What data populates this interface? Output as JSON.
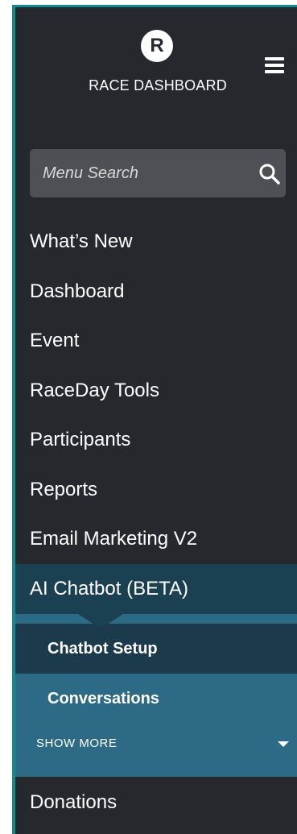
{
  "header": {
    "logo_letter": "R",
    "brand": "RACE DASHBOARD"
  },
  "search": {
    "placeholder": "Menu Search"
  },
  "nav": {
    "items": [
      {
        "label": "What’s New"
      },
      {
        "label": "Dashboard"
      },
      {
        "label": "Event"
      },
      {
        "label": "RaceDay Tools"
      },
      {
        "label": "Participants"
      },
      {
        "label": "Reports"
      },
      {
        "label": "Email Marketing V2"
      },
      {
        "label": "AI Chatbot (BETA)",
        "active": true
      },
      {
        "label": "Donations"
      }
    ],
    "submenu": {
      "items": [
        {
          "label": "Chatbot Setup",
          "active": true
        },
        {
          "label": "Conversations"
        }
      ],
      "show_more": "SHOW  MORE"
    }
  },
  "colors": {
    "sidebar_bg": "#25282d",
    "accent_border": "#138a8e",
    "active_bg": "#1b4052",
    "submenu_bg": "#2d6a86",
    "sub_active_bg": "#1b3a4b",
    "search_bg": "#4e5055"
  },
  "icons": {
    "search": "search-icon",
    "menu": "hamburger-menu-icon",
    "expand": "caret-down-icon"
  }
}
